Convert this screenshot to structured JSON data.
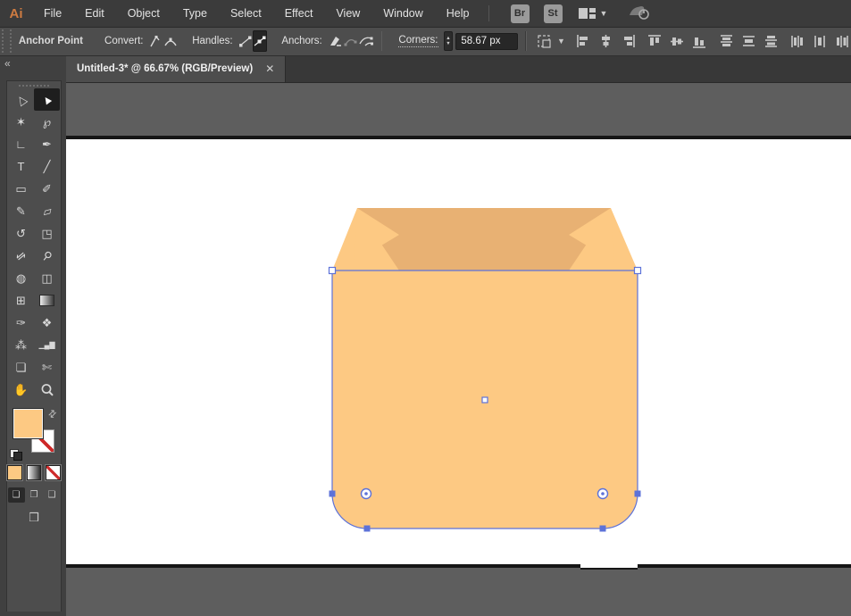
{
  "menu_bar": {
    "logo": "Ai",
    "items": [
      "File",
      "Edit",
      "Object",
      "Type",
      "Select",
      "Effect",
      "View",
      "Window",
      "Help"
    ],
    "bridge_label": "Br",
    "stock_label": "St"
  },
  "control_bar": {
    "title": "Anchor Point",
    "convert_label": "Convert:",
    "handles_label": "Handles:",
    "anchors_label": "Anchors:",
    "corners_label": "Corners:",
    "corners_value": "58.67 px",
    "stepper_up": "▲",
    "stepper_down": "▼",
    "align_icon_names": [
      "align-horizontal-left",
      "align-horizontal-center",
      "align-horizontal-right",
      "align-vertical-top",
      "align-vertical-center",
      "align-vertical-bottom",
      "distribute-vertical-top",
      "distribute-vertical-center",
      "distribute-vertical-bottom",
      "distribute-horizontal-left",
      "distribute-horizontal-center",
      "distribute-horizontal-right"
    ]
  },
  "tab_bar": {
    "active_tab": "Untitled-3* @ 66.67% (RGB/Preview)",
    "close_glyph": "✕"
  },
  "tool_panel": {
    "collapse_glyph": "«",
    "tools": [
      {
        "name": "direct-selection-tool",
        "glyph": "△",
        "rot": -35,
        "active": false
      },
      {
        "name": "selection-tool",
        "glyph": "▲",
        "rot": -35,
        "active": true
      },
      {
        "name": "magic-wand-tool",
        "glyph": "✶",
        "rot": 0,
        "active": false
      },
      {
        "name": "lasso-tool",
        "glyph": "℘",
        "rot": 0,
        "active": false
      },
      {
        "name": "curvature-tool",
        "glyph": "∟",
        "rot": 0,
        "active": false
      },
      {
        "name": "pen-tool",
        "glyph": "✒",
        "rot": 0,
        "active": false
      },
      {
        "name": "type-tool",
        "glyph": "T",
        "rot": 0,
        "active": false
      },
      {
        "name": "line-segment-tool",
        "glyph": "╱",
        "rot": 0,
        "active": false
      },
      {
        "name": "rectangle-tool",
        "glyph": "▭",
        "rot": 0,
        "active": false
      },
      {
        "name": "paintbrush-tool",
        "glyph": "✐",
        "rot": 0,
        "active": false
      },
      {
        "name": "shaper-tool",
        "glyph": "✎",
        "rot": 0,
        "active": false
      },
      {
        "name": "eraser-tool",
        "glyph": "▱",
        "rot": -15,
        "active": false
      },
      {
        "name": "rotate-tool",
        "glyph": "↺",
        "rot": 0,
        "active": false
      },
      {
        "name": "scale-tool",
        "glyph": "◳",
        "rot": 0,
        "active": false
      },
      {
        "name": "width-tool",
        "glyph": "⇋",
        "rot": -40,
        "active": false
      },
      {
        "name": "puppet-warp-tool",
        "glyph": "⚲",
        "rot": 40,
        "active": false
      },
      {
        "name": "shape-builder-tool",
        "glyph": "◍",
        "rot": 0,
        "active": false
      },
      {
        "name": "perspective-grid-tool",
        "glyph": "◫",
        "rot": 0,
        "active": false
      },
      {
        "name": "mesh-tool",
        "glyph": "⊞",
        "rot": 0,
        "active": false
      },
      {
        "name": "gradient-tool",
        "glyph": "",
        "rot": 0,
        "active": false,
        "special": "gradient"
      },
      {
        "name": "eyedropper-tool",
        "glyph": "✑",
        "rot": 0,
        "active": false
      },
      {
        "name": "blend-tool",
        "glyph": "❖",
        "rot": 0,
        "active": false
      },
      {
        "name": "symbol-sprayer-tool",
        "glyph": "⁂",
        "rot": 0,
        "active": false
      },
      {
        "name": "column-graph-tool",
        "glyph": "▁▄▇",
        "rot": 0,
        "active": false,
        "small": true
      },
      {
        "name": "artboard-tool",
        "glyph": "❏",
        "rot": 0,
        "active": false
      },
      {
        "name": "slice-tool",
        "glyph": "✄",
        "rot": 0,
        "active": false
      },
      {
        "name": "hand-tool",
        "glyph": "✋",
        "rot": 0,
        "active": false
      },
      {
        "name": "zoom-tool",
        "glyph": "",
        "rot": 0,
        "active": false,
        "special": "zoom"
      }
    ],
    "fill_color": "#FDC983",
    "stroke_style": "none",
    "draw_mode_glyphs": [
      "❏",
      "❐",
      "❑"
    ],
    "screen_mode_glyph": "❒"
  },
  "canvas": {
    "pasteboard_color": "#5E5E5E",
    "artboard_color": "#FFFFFF",
    "artwork": {
      "body_color": "#FDC983",
      "inner_color": "#E8B173",
      "selection_color": "#5D72D8",
      "corner_radius_px": "58.67"
    }
  }
}
